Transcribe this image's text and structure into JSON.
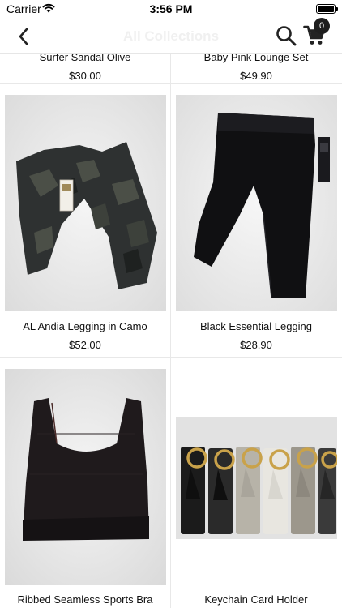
{
  "status_bar": {
    "carrier": "Carrier",
    "time": "3:56 PM"
  },
  "nav": {
    "title": "All Collections",
    "cart_count": "0"
  },
  "products": [
    {
      "name": "Surfer Sandal Olive",
      "price": "$30.00"
    },
    {
      "name": "Baby Pink Lounge Set",
      "price": "$49.90"
    },
    {
      "name": "AL Andia Legging in Camo",
      "price": "$52.00"
    },
    {
      "name": "Black Essential Legging",
      "price": "$28.90"
    },
    {
      "name": "Ribbed Seamless Sports Bra",
      "price": ""
    },
    {
      "name": "Keychain Card Holder",
      "price": ""
    }
  ],
  "icons": {
    "back": "chevron-left-icon",
    "search": "search-icon",
    "cart": "cart-icon",
    "wifi": "wifi-icon",
    "battery": "battery-icon"
  },
  "colors": {
    "nav_title": "#f0f0f0",
    "badge": "#1e1e1e",
    "divider": "#e8e8e8"
  }
}
